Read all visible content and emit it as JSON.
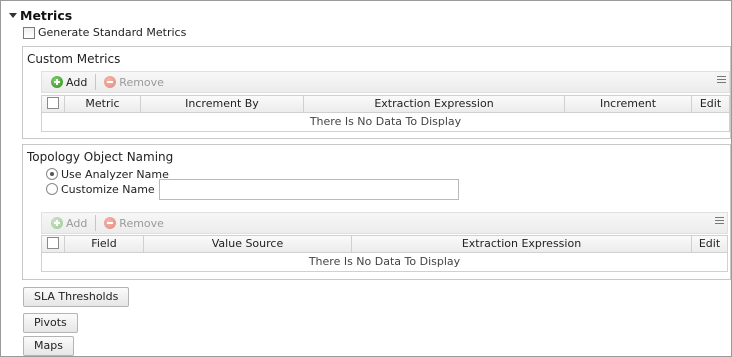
{
  "section": {
    "title": "Metrics"
  },
  "generate_standard": {
    "label": "Generate Standard Metrics",
    "checked": false
  },
  "custom_metrics": {
    "title": "Custom Metrics",
    "toolbar": {
      "add_label": "Add",
      "remove_label": "Remove",
      "add_enabled": true,
      "remove_enabled": false
    },
    "columns": [
      "Metric",
      "Increment By",
      "Extraction Expression",
      "Increment",
      "Edit"
    ],
    "empty_text": "There Is No Data To Display"
  },
  "topology": {
    "title": "Topology Object Naming",
    "options": [
      {
        "label": "Use Analyzer Name",
        "selected": true
      },
      {
        "label": "Customize Name",
        "selected": false
      }
    ],
    "customize_value": "",
    "toolbar": {
      "add_label": "Add",
      "remove_label": "Remove",
      "add_enabled": false,
      "remove_enabled": false
    },
    "columns": [
      "Field",
      "Value Source",
      "Extraction Expression",
      "Edit"
    ],
    "empty_text": "There Is No Data To Display"
  },
  "buttons": {
    "sla": "SLA Thresholds",
    "pivots": "Pivots",
    "maps": "Maps"
  }
}
